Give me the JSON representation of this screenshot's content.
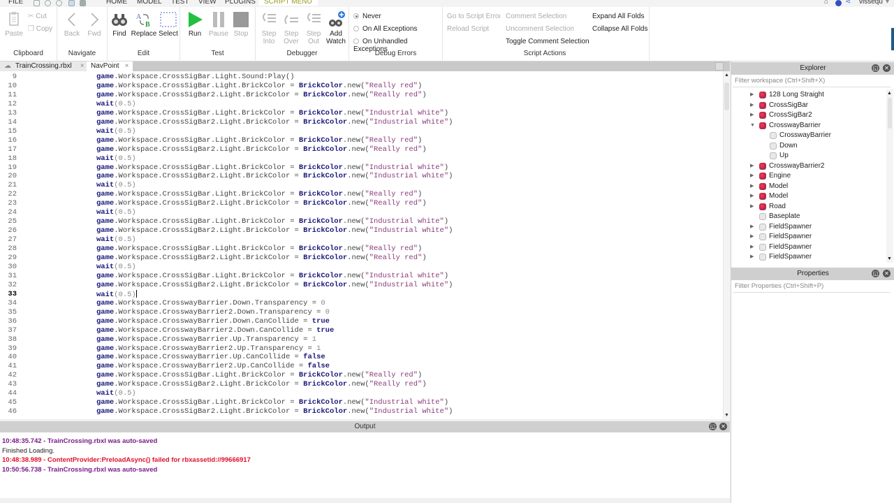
{
  "menubar": {
    "items": [
      "FILE",
      "HOME",
      "MODEL",
      "TEST",
      "VIEW",
      "PLUGINS",
      "SCRIPT MENU"
    ],
    "active": "SCRIPT MENU",
    "username": "vissequ"
  },
  "ribbon": {
    "clipboard": {
      "label": "Clipboard",
      "paste": "Paste",
      "cut": "Cut",
      "copy": "Copy"
    },
    "navigate": {
      "label": "Navigate",
      "back": "Back",
      "fwd": "Fwd"
    },
    "edit": {
      "label": "Edit",
      "find": "Find",
      "replace": "Replace",
      "select": "Select"
    },
    "test": {
      "label": "Test",
      "run": "Run",
      "pause": "Pause",
      "stop": "Stop"
    },
    "debugger": {
      "label": "Debugger",
      "step_into": [
        "Step",
        "Into"
      ],
      "step_over": [
        "Step",
        "Over"
      ],
      "step_out": [
        "Step",
        "Out"
      ],
      "add_watch": [
        "Add",
        "Watch"
      ]
    },
    "debug_errors": {
      "label": "Debug Errors",
      "options": [
        "Never",
        "On All Exceptions",
        "On Unhandled Exceptions"
      ],
      "selected": "Never"
    },
    "script_actions": {
      "label": "Script Actions",
      "go_to_error": "Go to Script Error",
      "reload": "Reload Script",
      "comment": "Comment Selection",
      "uncomment": "Uncomment Selection",
      "toggle_comment": "Toggle Comment Selection",
      "expand": "Expand All Folds",
      "collapse": "Collapse All Folds"
    }
  },
  "tabs": [
    {
      "label": "TrainCrossing.rbxl",
      "active": false
    },
    {
      "label": "NavPoint",
      "active": true
    }
  ],
  "editor": {
    "current_line": 33,
    "lines": [
      {
        "n": 9,
        "parts": [
          [
            "kw",
            "game"
          ],
          [
            "p",
            ".Workspace.CrossSigBar.Light.Sound:Play()"
          ]
        ]
      },
      {
        "n": 10,
        "parts": [
          [
            "kw",
            "game"
          ],
          [
            "p",
            ".Workspace.CrossSigBar.Light.BrickColor = "
          ],
          [
            "kw",
            "BrickColor"
          ],
          [
            "p",
            ".new("
          ],
          [
            "str",
            "\"Really red\""
          ],
          [
            "p",
            ")"
          ]
        ]
      },
      {
        "n": 11,
        "parts": [
          [
            "kw",
            "game"
          ],
          [
            "p",
            ".Workspace.CrossSigBar2.Light.BrickColor = "
          ],
          [
            "kw",
            "BrickColor"
          ],
          [
            "p",
            ".new("
          ],
          [
            "str",
            "\"Really red\""
          ],
          [
            "p",
            ")"
          ]
        ]
      },
      {
        "n": 12,
        "parts": [
          [
            "kw",
            "wait"
          ],
          [
            "num",
            "(0.5)"
          ]
        ]
      },
      {
        "n": 13,
        "parts": [
          [
            "kw",
            "game"
          ],
          [
            "p",
            ".Workspace.CrossSigBar.Light.BrickColor = "
          ],
          [
            "kw",
            "BrickColor"
          ],
          [
            "p",
            ".new("
          ],
          [
            "str",
            "\"Industrial white\""
          ],
          [
            "p",
            ")"
          ]
        ]
      },
      {
        "n": 14,
        "parts": [
          [
            "kw",
            "game"
          ],
          [
            "p",
            ".Workspace.CrossSigBar2.Light.BrickColor = "
          ],
          [
            "kw",
            "BrickColor"
          ],
          [
            "p",
            ".new("
          ],
          [
            "str",
            "\"Industrial white\""
          ],
          [
            "p",
            ")"
          ]
        ]
      },
      {
        "n": 15,
        "parts": [
          [
            "kw",
            "wait"
          ],
          [
            "num",
            "(0.5)"
          ]
        ]
      },
      {
        "n": 16,
        "parts": [
          [
            "kw",
            "game"
          ],
          [
            "p",
            ".Workspace.CrossSigBar.Light.BrickColor = "
          ],
          [
            "kw",
            "BrickColor"
          ],
          [
            "p",
            ".new("
          ],
          [
            "str",
            "\"Really red\""
          ],
          [
            "p",
            ")"
          ]
        ]
      },
      {
        "n": 17,
        "parts": [
          [
            "kw",
            "game"
          ],
          [
            "p",
            ".Workspace.CrossSigBar2.Light.BrickColor = "
          ],
          [
            "kw",
            "BrickColor"
          ],
          [
            "p",
            ".new("
          ],
          [
            "str",
            "\"Really red\""
          ],
          [
            "p",
            ")"
          ]
        ]
      },
      {
        "n": 18,
        "parts": [
          [
            "kw",
            "wait"
          ],
          [
            "num",
            "(0.5)"
          ]
        ]
      },
      {
        "n": 19,
        "parts": [
          [
            "kw",
            "game"
          ],
          [
            "p",
            ".Workspace.CrossSigBar.Light.BrickColor = "
          ],
          [
            "kw",
            "BrickColor"
          ],
          [
            "p",
            ".new("
          ],
          [
            "str",
            "\"Industrial white\""
          ],
          [
            "p",
            ")"
          ]
        ]
      },
      {
        "n": 20,
        "parts": [
          [
            "kw",
            "game"
          ],
          [
            "p",
            ".Workspace.CrossSigBar2.Light.BrickColor = "
          ],
          [
            "kw",
            "BrickColor"
          ],
          [
            "p",
            ".new("
          ],
          [
            "str",
            "\"Industrial white\""
          ],
          [
            "p",
            ")"
          ]
        ]
      },
      {
        "n": 21,
        "parts": [
          [
            "kw",
            "wait"
          ],
          [
            "num",
            "(0.5)"
          ]
        ]
      },
      {
        "n": 22,
        "parts": [
          [
            "kw",
            "game"
          ],
          [
            "p",
            ".Workspace.CrossSigBar.Light.BrickColor = "
          ],
          [
            "kw",
            "BrickColor"
          ],
          [
            "p",
            ".new("
          ],
          [
            "str",
            "\"Really red\""
          ],
          [
            "p",
            ")"
          ]
        ]
      },
      {
        "n": 23,
        "parts": [
          [
            "kw",
            "game"
          ],
          [
            "p",
            ".Workspace.CrossSigBar2.Light.BrickColor = "
          ],
          [
            "kw",
            "BrickColor"
          ],
          [
            "p",
            ".new("
          ],
          [
            "str",
            "\"Really red\""
          ],
          [
            "p",
            ")"
          ]
        ]
      },
      {
        "n": 24,
        "parts": [
          [
            "kw",
            "wait"
          ],
          [
            "num",
            "(0.5)"
          ]
        ]
      },
      {
        "n": 25,
        "parts": [
          [
            "kw",
            "game"
          ],
          [
            "p",
            ".Workspace.CrossSigBar.Light.BrickColor = "
          ],
          [
            "kw",
            "BrickColor"
          ],
          [
            "p",
            ".new("
          ],
          [
            "str",
            "\"Industrial white\""
          ],
          [
            "p",
            ")"
          ]
        ]
      },
      {
        "n": 26,
        "parts": [
          [
            "kw",
            "game"
          ],
          [
            "p",
            ".Workspace.CrossSigBar2.Light.BrickColor = "
          ],
          [
            "kw",
            "BrickColor"
          ],
          [
            "p",
            ".new("
          ],
          [
            "str",
            "\"Industrial white\""
          ],
          [
            "p",
            ")"
          ]
        ]
      },
      {
        "n": 27,
        "parts": [
          [
            "kw",
            "wait"
          ],
          [
            "num",
            "(0.5)"
          ]
        ]
      },
      {
        "n": 28,
        "parts": [
          [
            "kw",
            "game"
          ],
          [
            "p",
            ".Workspace.CrossSigBar.Light.BrickColor = "
          ],
          [
            "kw",
            "BrickColor"
          ],
          [
            "p",
            ".new("
          ],
          [
            "str",
            "\"Really red\""
          ],
          [
            "p",
            ")"
          ]
        ]
      },
      {
        "n": 29,
        "parts": [
          [
            "kw",
            "game"
          ],
          [
            "p",
            ".Workspace.CrossSigBar2.Light.BrickColor = "
          ],
          [
            "kw",
            "BrickColor"
          ],
          [
            "p",
            ".new("
          ],
          [
            "str",
            "\"Really red\""
          ],
          [
            "p",
            ")"
          ]
        ]
      },
      {
        "n": 30,
        "parts": [
          [
            "kw",
            "wait"
          ],
          [
            "num",
            "(0.5)"
          ]
        ]
      },
      {
        "n": 31,
        "parts": [
          [
            "kw",
            "game"
          ],
          [
            "p",
            ".Workspace.CrossSigBar.Light.BrickColor = "
          ],
          [
            "kw",
            "BrickColor"
          ],
          [
            "p",
            ".new("
          ],
          [
            "str",
            "\"Industrial white\""
          ],
          [
            "p",
            ")"
          ]
        ]
      },
      {
        "n": 32,
        "parts": [
          [
            "kw",
            "game"
          ],
          [
            "p",
            ".Workspace.CrossSigBar2.Light.BrickColor = "
          ],
          [
            "kw",
            "BrickColor"
          ],
          [
            "p",
            ".new("
          ],
          [
            "str",
            "\"Industrial white\""
          ],
          [
            "p",
            ")"
          ]
        ]
      },
      {
        "n": 33,
        "parts": [
          [
            "kw",
            "wait"
          ],
          [
            "num",
            "(0.5)"
          ]
        ]
      },
      {
        "n": 34,
        "parts": [
          [
            "kw",
            "game"
          ],
          [
            "p",
            ".Workspace.CrosswayBarrier.Down.Transparency = "
          ],
          [
            "num",
            "0"
          ]
        ]
      },
      {
        "n": 35,
        "parts": [
          [
            "kw",
            "game"
          ],
          [
            "p",
            ".Workspace.CrosswayBarrier2.Down.Transparency = "
          ],
          [
            "num",
            "0"
          ]
        ]
      },
      {
        "n": 36,
        "parts": [
          [
            "kw",
            "game"
          ],
          [
            "p",
            ".Workspace.CrosswayBarrier.Down.CanCollide = "
          ],
          [
            "bool",
            "true"
          ]
        ]
      },
      {
        "n": 37,
        "parts": [
          [
            "kw",
            "game"
          ],
          [
            "p",
            ".Workspace.CrosswayBarrier2.Down.CanCollide = "
          ],
          [
            "bool",
            "true"
          ]
        ]
      },
      {
        "n": 38,
        "parts": [
          [
            "kw",
            "game"
          ],
          [
            "p",
            ".Workspace.CrosswayBarrier.Up.Transparency = "
          ],
          [
            "num",
            "1"
          ]
        ]
      },
      {
        "n": 39,
        "parts": [
          [
            "kw",
            "game"
          ],
          [
            "p",
            ".Workspace.CrosswayBarrier2.Up.Transparency = "
          ],
          [
            "num",
            "1"
          ]
        ]
      },
      {
        "n": 40,
        "parts": [
          [
            "kw",
            "game"
          ],
          [
            "p",
            ".Workspace.CrosswayBarrier.Up.CanCollide = "
          ],
          [
            "bool",
            "false"
          ]
        ]
      },
      {
        "n": 41,
        "parts": [
          [
            "kw",
            "game"
          ],
          [
            "p",
            ".Workspace.CrosswayBarrier2.Up.CanCollide = "
          ],
          [
            "bool",
            "false"
          ]
        ]
      },
      {
        "n": 42,
        "parts": [
          [
            "kw",
            "game"
          ],
          [
            "p",
            ".Workspace.CrossSigBar.Light.BrickColor = "
          ],
          [
            "kw",
            "BrickColor"
          ],
          [
            "p",
            ".new("
          ],
          [
            "str",
            "\"Really red\""
          ],
          [
            "p",
            ")"
          ]
        ]
      },
      {
        "n": 43,
        "parts": [
          [
            "kw",
            "game"
          ],
          [
            "p",
            ".Workspace.CrossSigBar2.Light.BrickColor = "
          ],
          [
            "kw",
            "BrickColor"
          ],
          [
            "p",
            ".new("
          ],
          [
            "str",
            "\"Really red\""
          ],
          [
            "p",
            ")"
          ]
        ]
      },
      {
        "n": 44,
        "parts": [
          [
            "kw",
            "wait"
          ],
          [
            "num",
            "(0.5)"
          ]
        ]
      },
      {
        "n": 45,
        "parts": [
          [
            "kw",
            "game"
          ],
          [
            "p",
            ".Workspace.CrossSigBar.Light.BrickColor = "
          ],
          [
            "kw",
            "BrickColor"
          ],
          [
            "p",
            ".new("
          ],
          [
            "str",
            "\"Industrial white\""
          ],
          [
            "p",
            ")"
          ]
        ]
      },
      {
        "n": 46,
        "parts": [
          [
            "kw",
            "game"
          ],
          [
            "p",
            ".Workspace.CrossSigBar2.Light.BrickColor = "
          ],
          [
            "kw",
            "BrickColor"
          ],
          [
            "p",
            ".new("
          ],
          [
            "str",
            "\"Industrial white\""
          ],
          [
            "p",
            ")"
          ]
        ]
      }
    ]
  },
  "output": {
    "title": "Output",
    "lines": [
      {
        "text": "10:48:35.742 - TrainCrossing.rbxl was auto-saved",
        "kind": "info",
        "color": "#7a1a8a"
      },
      {
        "text": "Finished Loading.",
        "kind": "plain",
        "color": "#222222"
      },
      {
        "text": "10:48:38.989 - ContentProvider:PreloadAsync() failed for rbxassetid://99666917",
        "kind": "error",
        "color": "#e0102a"
      },
      {
        "text": "10:50:56.738 - TrainCrossing.rbxl was auto-saved",
        "kind": "info",
        "color": "#7a1a8a"
      }
    ]
  },
  "explorer": {
    "title": "Explorer",
    "filter_placeholder": "Filter workspace (Ctrl+Shift+X)",
    "items": [
      {
        "label": "128 Long Straight",
        "icon": "model",
        "depth": 0,
        "expander": "collapsed"
      },
      {
        "label": "CrossSigBar",
        "icon": "model",
        "depth": 0,
        "expander": "collapsed"
      },
      {
        "label": "CrossSigBar2",
        "icon": "model",
        "depth": 0,
        "expander": "collapsed"
      },
      {
        "label": "CrosswayBarrier",
        "icon": "model",
        "depth": 0,
        "expander": "expanded"
      },
      {
        "label": "CrosswayBarrier",
        "icon": "part",
        "depth": 1,
        "expander": "none"
      },
      {
        "label": "Down",
        "icon": "part",
        "depth": 1,
        "expander": "none"
      },
      {
        "label": "Up",
        "icon": "part",
        "depth": 1,
        "expander": "none"
      },
      {
        "label": "CrosswayBarrier2",
        "icon": "model",
        "depth": 0,
        "expander": "collapsed"
      },
      {
        "label": "Engine",
        "icon": "model",
        "depth": 0,
        "expander": "collapsed"
      },
      {
        "label": "Model",
        "icon": "model",
        "depth": 0,
        "expander": "collapsed"
      },
      {
        "label": "Model",
        "icon": "model",
        "depth": 0,
        "expander": "collapsed"
      },
      {
        "label": "Road",
        "icon": "model",
        "depth": 0,
        "expander": "collapsed"
      },
      {
        "label": "Baseplate",
        "icon": "part",
        "depth": 0,
        "expander": "none"
      },
      {
        "label": "FieldSpawner",
        "icon": "part",
        "depth": 0,
        "expander": "collapsed"
      },
      {
        "label": "FieldSpawner",
        "icon": "part",
        "depth": 0,
        "expander": "collapsed"
      },
      {
        "label": "FieldSpawner",
        "icon": "part",
        "depth": 0,
        "expander": "collapsed"
      },
      {
        "label": "FieldSpawner",
        "icon": "part",
        "depth": 0,
        "expander": "collapsed"
      }
    ]
  },
  "properties": {
    "title": "Properties",
    "filter_placeholder": "Filter Properties (Ctrl+Shift+P)"
  },
  "icons": {
    "close": "×",
    "restore": "▫",
    "arrow_up": "▲",
    "arrow_down": "▼",
    "tree_collapsed": "▶",
    "tree_expanded": "▼",
    "circle_close": "✕",
    "circle_restore": "◱"
  }
}
